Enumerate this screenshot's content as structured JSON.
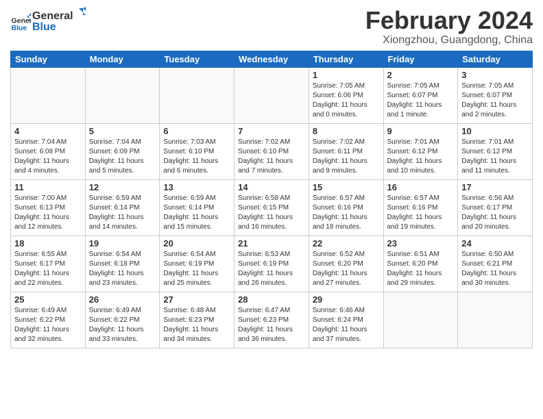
{
  "logo": {
    "line1": "General",
    "line2": "Blue"
  },
  "title": "February 2024",
  "subtitle": "Xiongzhou, Guangdong, China",
  "days_of_week": [
    "Sunday",
    "Monday",
    "Tuesday",
    "Wednesday",
    "Thursday",
    "Friday",
    "Saturday"
  ],
  "weeks": [
    [
      {
        "num": "",
        "info": ""
      },
      {
        "num": "",
        "info": ""
      },
      {
        "num": "",
        "info": ""
      },
      {
        "num": "",
        "info": ""
      },
      {
        "num": "1",
        "info": "Sunrise: 7:05 AM\nSunset: 6:06 PM\nDaylight: 11 hours\nand 0 minutes."
      },
      {
        "num": "2",
        "info": "Sunrise: 7:05 AM\nSunset: 6:07 PM\nDaylight: 11 hours\nand 1 minute."
      },
      {
        "num": "3",
        "info": "Sunrise: 7:05 AM\nSunset: 6:07 PM\nDaylight: 11 hours\nand 2 minutes."
      }
    ],
    [
      {
        "num": "4",
        "info": "Sunrise: 7:04 AM\nSunset: 6:08 PM\nDaylight: 11 hours\nand 4 minutes."
      },
      {
        "num": "5",
        "info": "Sunrise: 7:04 AM\nSunset: 6:09 PM\nDaylight: 11 hours\nand 5 minutes."
      },
      {
        "num": "6",
        "info": "Sunrise: 7:03 AM\nSunset: 6:10 PM\nDaylight: 11 hours\nand 6 minutes."
      },
      {
        "num": "7",
        "info": "Sunrise: 7:02 AM\nSunset: 6:10 PM\nDaylight: 11 hours\nand 7 minutes."
      },
      {
        "num": "8",
        "info": "Sunrise: 7:02 AM\nSunset: 6:11 PM\nDaylight: 11 hours\nand 9 minutes."
      },
      {
        "num": "9",
        "info": "Sunrise: 7:01 AM\nSunset: 6:12 PM\nDaylight: 11 hours\nand 10 minutes."
      },
      {
        "num": "10",
        "info": "Sunrise: 7:01 AM\nSunset: 6:12 PM\nDaylight: 11 hours\nand 11 minutes."
      }
    ],
    [
      {
        "num": "11",
        "info": "Sunrise: 7:00 AM\nSunset: 6:13 PM\nDaylight: 11 hours\nand 12 minutes."
      },
      {
        "num": "12",
        "info": "Sunrise: 6:59 AM\nSunset: 6:14 PM\nDaylight: 11 hours\nand 14 minutes."
      },
      {
        "num": "13",
        "info": "Sunrise: 6:59 AM\nSunset: 6:14 PM\nDaylight: 11 hours\nand 15 minutes."
      },
      {
        "num": "14",
        "info": "Sunrise: 6:58 AM\nSunset: 6:15 PM\nDaylight: 11 hours\nand 16 minutes."
      },
      {
        "num": "15",
        "info": "Sunrise: 6:57 AM\nSunset: 6:16 PM\nDaylight: 11 hours\nand 18 minutes."
      },
      {
        "num": "16",
        "info": "Sunrise: 6:57 AM\nSunset: 6:16 PM\nDaylight: 11 hours\nand 19 minutes."
      },
      {
        "num": "17",
        "info": "Sunrise: 6:56 AM\nSunset: 6:17 PM\nDaylight: 11 hours\nand 20 minutes."
      }
    ],
    [
      {
        "num": "18",
        "info": "Sunrise: 6:55 AM\nSunset: 6:17 PM\nDaylight: 11 hours\nand 22 minutes."
      },
      {
        "num": "19",
        "info": "Sunrise: 6:54 AM\nSunset: 6:18 PM\nDaylight: 11 hours\nand 23 minutes."
      },
      {
        "num": "20",
        "info": "Sunrise: 6:54 AM\nSunset: 6:19 PM\nDaylight: 11 hours\nand 25 minutes."
      },
      {
        "num": "21",
        "info": "Sunrise: 6:53 AM\nSunset: 6:19 PM\nDaylight: 11 hours\nand 26 minutes."
      },
      {
        "num": "22",
        "info": "Sunrise: 6:52 AM\nSunset: 6:20 PM\nDaylight: 11 hours\nand 27 minutes."
      },
      {
        "num": "23",
        "info": "Sunrise: 6:51 AM\nSunset: 6:20 PM\nDaylight: 11 hours\nand 29 minutes."
      },
      {
        "num": "24",
        "info": "Sunrise: 6:50 AM\nSunset: 6:21 PM\nDaylight: 11 hours\nand 30 minutes."
      }
    ],
    [
      {
        "num": "25",
        "info": "Sunrise: 6:49 AM\nSunset: 6:22 PM\nDaylight: 11 hours\nand 32 minutes."
      },
      {
        "num": "26",
        "info": "Sunrise: 6:49 AM\nSunset: 6:22 PM\nDaylight: 11 hours\nand 33 minutes."
      },
      {
        "num": "27",
        "info": "Sunrise: 6:48 AM\nSunset: 6:23 PM\nDaylight: 11 hours\nand 34 minutes."
      },
      {
        "num": "28",
        "info": "Sunrise: 6:47 AM\nSunset: 6:23 PM\nDaylight: 11 hours\nand 36 minutes."
      },
      {
        "num": "29",
        "info": "Sunrise: 6:46 AM\nSunset: 6:24 PM\nDaylight: 11 hours\nand 37 minutes."
      },
      {
        "num": "",
        "info": ""
      },
      {
        "num": "",
        "info": ""
      }
    ]
  ]
}
